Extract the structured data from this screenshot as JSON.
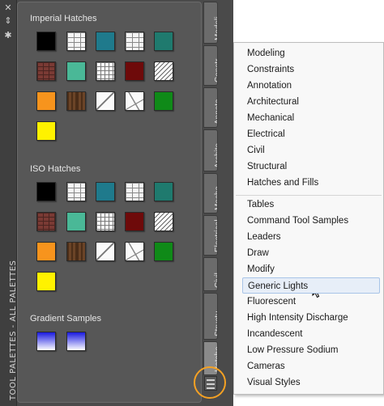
{
  "palette": {
    "title": "TOOL PALETTES - ALL PALETTES",
    "sections": [
      {
        "title": "Imperial Hatches",
        "tiles": [
          {
            "name": "solid-black",
            "pattern": "solid",
            "color": "#000000"
          },
          {
            "name": "brick-white",
            "pattern": "brick",
            "color": "#f4f4f4"
          },
          {
            "name": "solid-teal-blue",
            "pattern": "solid",
            "color": "#1f7a8c"
          },
          {
            "name": "brick-white-2",
            "pattern": "brick",
            "color": "#f4f4f4"
          },
          {
            "name": "solid-dark-teal",
            "pattern": "solid",
            "color": "#1f7a6e"
          },
          {
            "name": "red-brick",
            "pattern": "redbrick",
            "color": "#7a3a34"
          },
          {
            "name": "solid-sea-green",
            "pattern": "solid",
            "color": "#4ab897"
          },
          {
            "name": "grid-white",
            "pattern": "grid",
            "color": "#ffffff"
          },
          {
            "name": "solid-maroon",
            "pattern": "solid",
            "color": "#6e0a0a"
          },
          {
            "name": "diagonal-lines",
            "pattern": "diag",
            "color": "#ffffff"
          },
          {
            "name": "solid-orange",
            "pattern": "solid",
            "color": "#f7941d"
          },
          {
            "name": "parquet",
            "pattern": "parquet",
            "color": "#6b4427"
          },
          {
            "name": "earth",
            "pattern": "earth",
            "color": "#fafafa"
          },
          {
            "name": "rock",
            "pattern": "rock",
            "color": "#fafafa"
          },
          {
            "name": "solid-green",
            "pattern": "solid",
            "color": "#0f8a18"
          },
          {
            "name": "solid-yellow",
            "pattern": "solid",
            "color": "#fff200"
          }
        ]
      },
      {
        "title": "ISO Hatches",
        "tiles": [
          {
            "name": "solid-black",
            "pattern": "solid",
            "color": "#000000"
          },
          {
            "name": "brick-white",
            "pattern": "brick",
            "color": "#f4f4f4"
          },
          {
            "name": "solid-teal-blue",
            "pattern": "solid",
            "color": "#1f7a8c"
          },
          {
            "name": "brick-white-2",
            "pattern": "brick",
            "color": "#f4f4f4"
          },
          {
            "name": "solid-dark-teal",
            "pattern": "solid",
            "color": "#1f7a6e"
          },
          {
            "name": "red-brick",
            "pattern": "redbrick",
            "color": "#7a3a34"
          },
          {
            "name": "solid-sea-green",
            "pattern": "solid",
            "color": "#4ab897"
          },
          {
            "name": "grid-white",
            "pattern": "grid",
            "color": "#ffffff"
          },
          {
            "name": "solid-maroon",
            "pattern": "solid",
            "color": "#6e0a0a"
          },
          {
            "name": "diagonal-lines",
            "pattern": "diag",
            "color": "#ffffff"
          },
          {
            "name": "solid-orange",
            "pattern": "solid",
            "color": "#f7941d"
          },
          {
            "name": "parquet",
            "pattern": "parquet",
            "color": "#6b4427"
          },
          {
            "name": "earth",
            "pattern": "earth",
            "color": "#fafafa"
          },
          {
            "name": "rock",
            "pattern": "rock",
            "color": "#fafafa"
          },
          {
            "name": "solid-green",
            "pattern": "solid",
            "color": "#0f8a18"
          },
          {
            "name": "solid-yellow",
            "pattern": "solid",
            "color": "#fff200"
          }
        ]
      },
      {
        "title": "Gradient Samples",
        "tiles": [
          {
            "name": "gradient-blue-white",
            "pattern": "grad",
            "color": "#1a1ae0"
          },
          {
            "name": "gradient-blue-white-2",
            "pattern": "grad",
            "color": "#1a1ae0"
          }
        ]
      }
    ],
    "tabs": [
      {
        "label": "Modeli..."
      },
      {
        "label": "Constr..."
      },
      {
        "label": "Annota..."
      },
      {
        "label": "Archite..."
      },
      {
        "label": "Mecha..."
      },
      {
        "label": "Electrical"
      },
      {
        "label": "Civil"
      },
      {
        "label": "Structu..."
      },
      {
        "label": "Hatche..."
      }
    ],
    "active_tab": "Hatche...",
    "strip_icons": [
      "close-icon",
      "pin-icon",
      "settings-icon"
    ]
  },
  "menu": {
    "items": [
      "Modeling",
      "Constraints",
      "Annotation",
      "Architectural",
      "Mechanical",
      "Electrical",
      "Civil",
      "Structural",
      "Hatches and Fills",
      "Tables",
      "Command Tool Samples",
      "Leaders",
      "Draw",
      "Modify",
      "Generic Lights",
      "Fluorescent",
      "High Intensity Discharge",
      "Incandescent",
      "Low Pressure Sodium",
      "Cameras",
      "Visual Styles"
    ],
    "hover_item": "Generic Lights"
  },
  "colors": {
    "highlight_ring": "#f5a123",
    "menu_hover_fill": "#e7eef8",
    "menu_hover_border": "#a8c4e8"
  }
}
